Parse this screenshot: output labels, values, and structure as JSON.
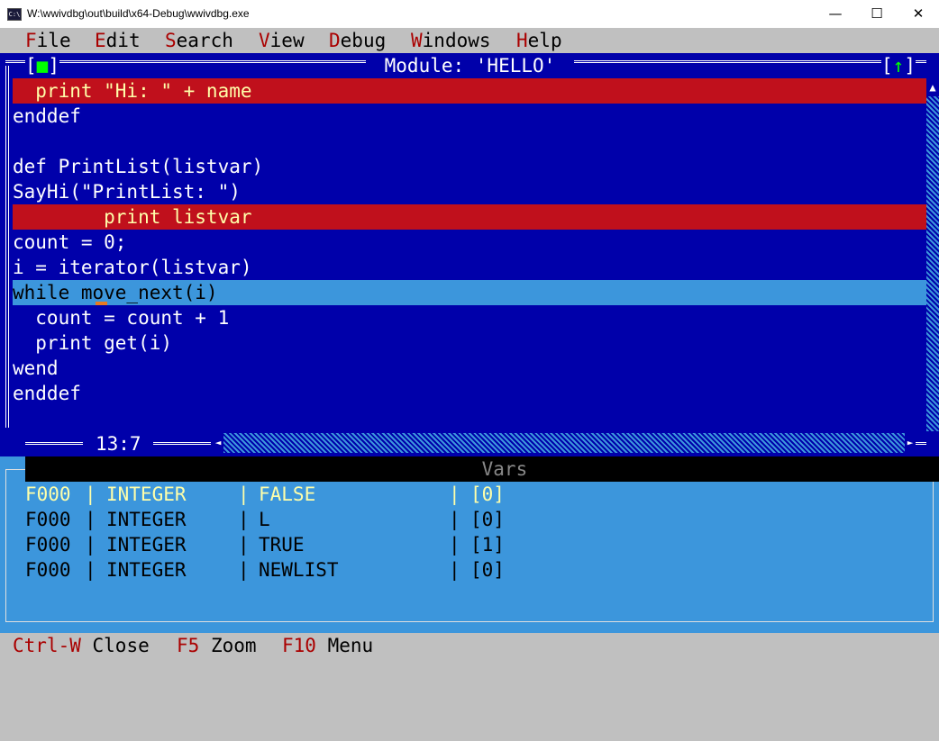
{
  "window": {
    "title": "W:\\wwivdbg\\out\\build\\x64-Debug\\wwivdbg.exe",
    "app_icon_text": "C:\\",
    "minimize": "—",
    "maximize": "☐",
    "close": "✕"
  },
  "menu": [
    {
      "hotkey": "F",
      "rest": "ile"
    },
    {
      "hotkey": "E",
      "rest": "dit"
    },
    {
      "hotkey": "S",
      "rest": "earch"
    },
    {
      "hotkey": "V",
      "rest": "iew"
    },
    {
      "hotkey": "D",
      "rest": "ebug"
    },
    {
      "hotkey": "W",
      "rest": "indows"
    },
    {
      "hotkey": "H",
      "rest": "elp"
    }
  ],
  "module_window": {
    "title": " Module: 'HELLO' ",
    "close_button": "[■]",
    "zoom_button": "[↑]",
    "cursor_position": "13:7",
    "lines": [
      {
        "text": "  print \"Hi: \" + name",
        "state": "breakpoint"
      },
      {
        "text": "enddef",
        "state": "normal"
      },
      {
        "text": "",
        "state": "normal"
      },
      {
        "text": "def PrintList(listvar)",
        "state": "normal"
      },
      {
        "text": "SayHi(\"PrintList: \")",
        "state": "normal"
      },
      {
        "text": "        print listvar",
        "state": "breakpoint"
      },
      {
        "text": "count = 0;",
        "state": "normal"
      },
      {
        "text": "i = iterator(listvar)",
        "state": "normal"
      },
      {
        "text": "while move_next(i)",
        "state": "current"
      },
      {
        "text": "  count = count + 1",
        "state": "normal"
      },
      {
        "text": "  print get(i)",
        "state": "normal"
      },
      {
        "text": "wend",
        "state": "normal"
      },
      {
        "text": "enddef",
        "state": "normal"
      },
      {
        "text": "",
        "state": "normal"
      }
    ],
    "scroll_up": "▲",
    "scroll_down": "▼",
    "scroll_left": "◄",
    "scroll_right": "►"
  },
  "vars_window": {
    "title": " Vars ",
    "rows": [
      {
        "addr": "F000",
        "type": "INTEGER",
        "value": "FALSE",
        "index": "[0]",
        "selected": true
      },
      {
        "addr": "F000",
        "type": "INTEGER",
        "value": "L",
        "index": "[0]",
        "selected": false
      },
      {
        "addr": "F000",
        "type": "INTEGER",
        "value": "TRUE",
        "index": "[1]",
        "selected": false
      },
      {
        "addr": "F000",
        "type": "INTEGER",
        "value": "NEWLIST",
        "index": "[0]",
        "selected": false
      }
    ],
    "separator": "|"
  },
  "status_bar": [
    {
      "key": "Ctrl-W",
      "label": "Close"
    },
    {
      "key": "F5",
      "label": "Zoom"
    },
    {
      "key": "F10",
      "label": "Menu"
    }
  ],
  "colors": {
    "desktop": "#c0c0c0",
    "editor_bg": "#0000aa",
    "breakpoint_bg": "#c0101c",
    "current_line_bg": "#3c96dc",
    "vars_bg": "#3c96dc",
    "hotkey": "#aa0000",
    "highlight_text": "#ffffaa"
  }
}
